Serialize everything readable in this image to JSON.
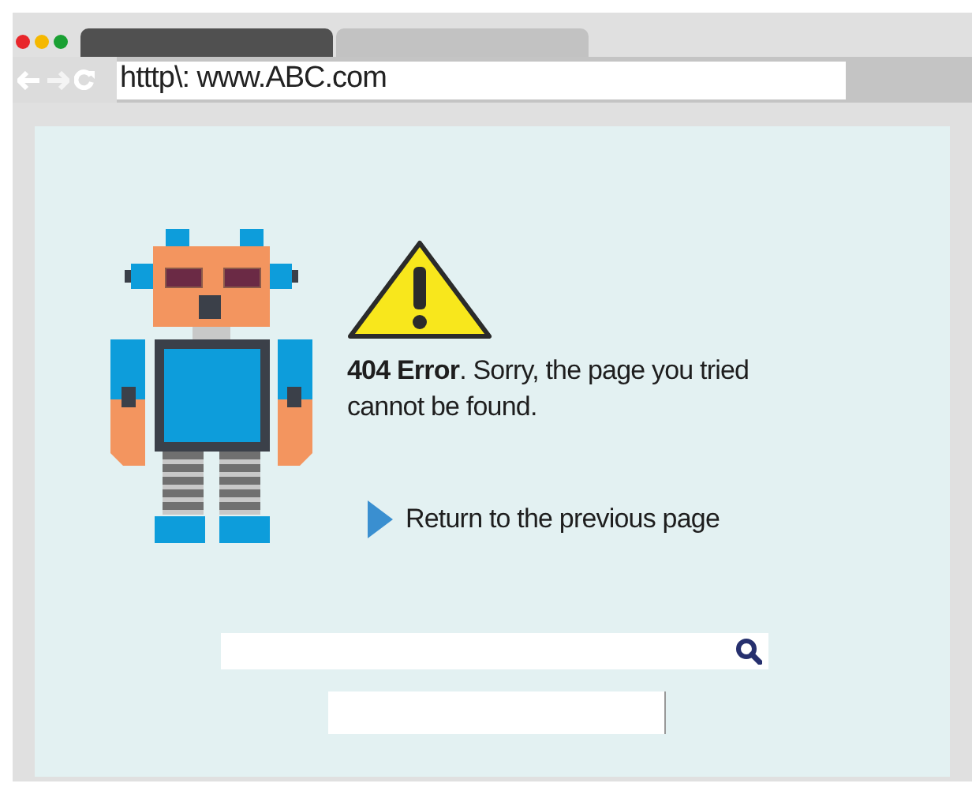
{
  "window": {
    "traffic_lights": [
      {
        "color": "#e8262b"
      },
      {
        "color": "#f5b800"
      },
      {
        "color": "#1aa033"
      }
    ]
  },
  "tabs": [
    {
      "selected": true
    },
    {
      "selected": false
    }
  ],
  "address_bar": {
    "value": "htttp\\: www.ABC.com"
  },
  "error": {
    "message": "**404 Error**. Sorry, the page you tried cannot be found.",
    "link": "Return to the previous page"
  }
}
